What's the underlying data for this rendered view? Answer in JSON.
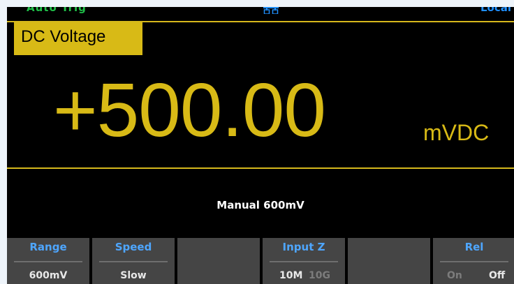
{
  "status_bar": {
    "trigger_mode": "Auto Trig",
    "lan_icon": "lan-icon",
    "remote_state": "Local"
  },
  "measurement": {
    "function": "DC Voltage",
    "reading": "+500.00",
    "unit": "mVDC",
    "range_info": "Manual 600mV"
  },
  "softkeys": {
    "range": {
      "title": "Range",
      "value": "600mV"
    },
    "speed": {
      "title": "Speed",
      "value": "Slow"
    },
    "blank1": {
      "title": ""
    },
    "input_z": {
      "title": "Input Z",
      "options": [
        "10M",
        "10G"
      ],
      "selected": "10M"
    },
    "blank2": {
      "title": ""
    },
    "rel": {
      "title": "Rel",
      "options": [
        "On",
        "Off"
      ],
      "selected": "Off"
    }
  },
  "colors": {
    "background": "#000000",
    "measurement_yellow": "#d8ba16",
    "trigger_green": "#1fbf48",
    "softkey_title_blue": "#4ea6ff",
    "softkey_bg": "#454545"
  }
}
